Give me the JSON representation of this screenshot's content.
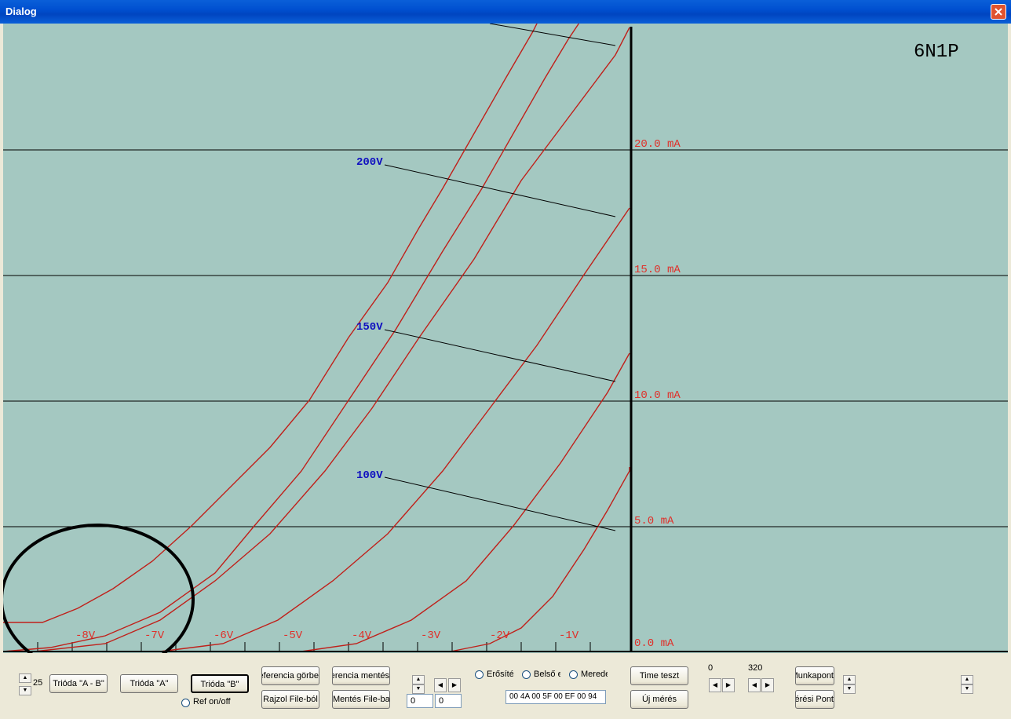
{
  "window": {
    "title": "Dialog"
  },
  "plot": {
    "tube_name": "6N1P",
    "current_labels": [
      "20.0 mA",
      "15.0 mA",
      "10.0 mA",
      "5.0 mA",
      "0.0 mA"
    ],
    "grid_voltage_labels": [
      "-8V",
      "-7V",
      "-6V",
      "-5V",
      "-4V",
      "-3V",
      "-2V",
      "-1V"
    ],
    "anode_voltage_labels": [
      "200V",
      "150V",
      "100V"
    ],
    "curve_color": "#c0201a",
    "background_color": "#a4c8c1"
  },
  "controls": {
    "spin_value": "25",
    "trioda_ab": "Trióda \"A - B\"",
    "trioda_a": "Trióda \"A\"",
    "trioda_b": "Trióda  \"B\"",
    "ref_onoff": "Ref on/off",
    "referencia_gorbe": "Referencia görbe",
    "rajzol_file": "Rajzol File-ból",
    "referencia_mentes": "Referencia mentés",
    "mentes_file": "Mentés File-ba",
    "edit1": "0",
    "edit2": "0",
    "radio_erosites": "Erősítés",
    "radio_belso": "Belső ellenállás",
    "radio_meredekseg": "Meredekség",
    "hex_data": "00 4A 00 5F 00 EF 00 94",
    "time_teszt": "Time teszt",
    "uj_meres": "Új mérés",
    "value_zero": "0",
    "value_320": "320",
    "munkapont": "Munkapont",
    "meresi_pont": "Mérési Pont"
  }
}
